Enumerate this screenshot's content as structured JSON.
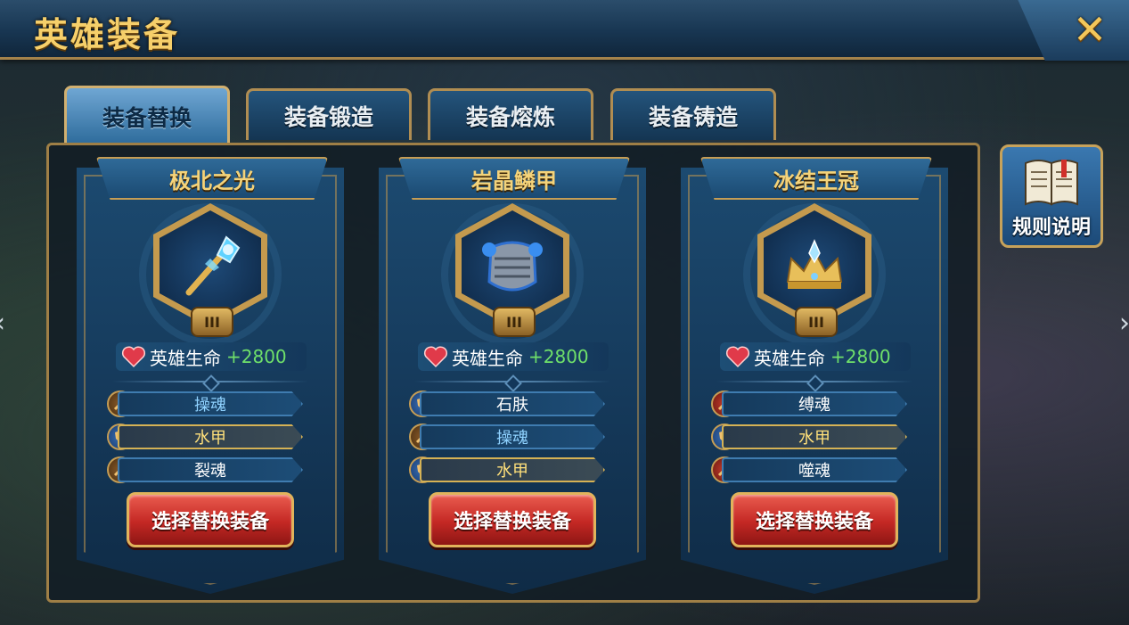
{
  "header": {
    "title": "英雄装备",
    "close_icon": "close-icon"
  },
  "tabs": [
    {
      "label": "装备替换",
      "active": true
    },
    {
      "label": "装备锻造",
      "active": false
    },
    {
      "label": "装备熔炼",
      "active": false
    },
    {
      "label": "装备铸造",
      "active": false
    }
  ],
  "rules": {
    "label": "规则说明",
    "icon": "book-icon"
  },
  "cards": [
    {
      "name": "极北之光",
      "item_icon": "ice-staff-icon",
      "rank": "III",
      "stat_label": "英雄生命",
      "stat_value": "+2800",
      "gems": [
        {
          "icon": "sword-gem-icon",
          "label": "操魂"
        },
        {
          "icon": "shield-gem-icon",
          "label": "水甲"
        },
        {
          "icon": "sword-gem-icon",
          "label": "裂魂"
        }
      ],
      "button": "选择替换装备"
    },
    {
      "name": "岩晶鳞甲",
      "item_icon": "armor-icon",
      "rank": "III",
      "stat_label": "英雄生命",
      "stat_value": "+2800",
      "gems": [
        {
          "icon": "shield-gem-icon",
          "label": "石肤"
        },
        {
          "icon": "sword-gem-icon",
          "label": "操魂"
        },
        {
          "icon": "shield-gem-icon",
          "label": "水甲"
        }
      ],
      "button": "选择替换装备"
    },
    {
      "name": "冰结王冠",
      "item_icon": "crown-icon",
      "rank": "III",
      "stat_label": "英雄生命",
      "stat_value": "+2800",
      "gems": [
        {
          "icon": "axe-gem-icon",
          "label": "缚魂"
        },
        {
          "icon": "shield-gem-icon",
          "label": "水甲"
        },
        {
          "icon": "axe-gem-icon",
          "label": "噬魂"
        }
      ],
      "button": "选择替换装备"
    }
  ],
  "colors": {
    "title_gold": "#f6cf6a",
    "stat_green": "#6fe06a",
    "button_red": "#c42824"
  }
}
